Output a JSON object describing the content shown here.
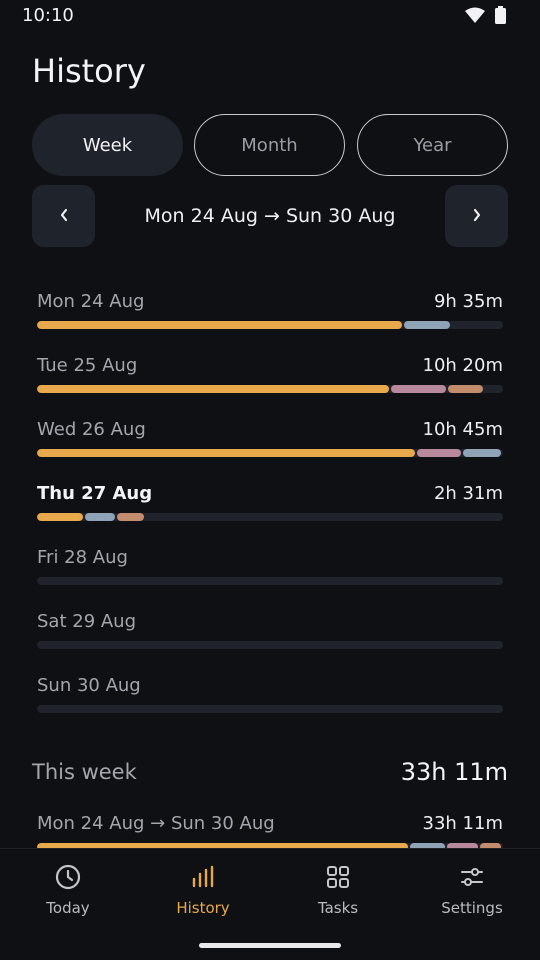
{
  "status_bar": {
    "time": "10:10",
    "wifi_icon": "wifi-icon",
    "battery_icon": "battery-icon"
  },
  "page": {
    "title": "History"
  },
  "range_tabs": [
    {
      "label": "Week",
      "active": true
    },
    {
      "label": "Month",
      "active": false
    },
    {
      "label": "Year",
      "active": false
    }
  ],
  "date_nav": {
    "prev_icon": "chevron-left-icon",
    "next_icon": "chevron-right-icon",
    "range": "Mon 24 Aug → Sun 30 Aug"
  },
  "colors": {
    "orange": "#e8a84c",
    "blue": "#8fa3b6",
    "pink": "#b8889c",
    "tan": "#c38c6c",
    "active_nav": "#e7a84a"
  },
  "days": [
    {
      "label": "Mon 24 Aug",
      "total": "9h 35m",
      "current": false,
      "segments": [
        {
          "color": "#e8a84c",
          "fraction": 0.788
        },
        {
          "color": "#8fa3b6",
          "fraction": 0.103
        }
      ]
    },
    {
      "label": "Tue 25 Aug",
      "total": "10h 20m",
      "current": false,
      "segments": [
        {
          "color": "#e8a84c",
          "fraction": 0.76
        },
        {
          "color": "#b8889c",
          "fraction": 0.122
        },
        {
          "color": "#c38c6c",
          "fraction": 0.079
        }
      ]
    },
    {
      "label": "Wed 26 Aug",
      "total": "10h 45m",
      "current": false,
      "segments": [
        {
          "color": "#e8a84c",
          "fraction": 0.815
        },
        {
          "color": "#b8889c",
          "fraction": 0.1
        },
        {
          "color": "#8fa3b6",
          "fraction": 0.085
        }
      ]
    },
    {
      "label": "Thu 27 Aug",
      "total": "2h 31m",
      "current": true,
      "segments": [
        {
          "color": "#e8a84c",
          "fraction": 0.103
        },
        {
          "color": "#8fa3b6",
          "fraction": 0.069
        },
        {
          "color": "#c38c6c",
          "fraction": 0.062
        }
      ]
    },
    {
      "label": "Fri 28 Aug",
      "total": "",
      "current": false,
      "segments": []
    },
    {
      "label": "Sat 29 Aug",
      "total": "",
      "current": false,
      "segments": []
    },
    {
      "label": "Sun 30 Aug",
      "total": "",
      "current": false,
      "segments": []
    }
  ],
  "week_summary": {
    "label": "This week",
    "total": "33h 11m",
    "range": "Mon 24 Aug → Sun 30 Aug",
    "range_total": "33h 11m",
    "segments": [
      {
        "color": "#e8a84c",
        "fraction": 0.8
      },
      {
        "color": "#8fa3b6",
        "fraction": 0.08
      },
      {
        "color": "#b8889c",
        "fraction": 0.07
      },
      {
        "color": "#c38c6c",
        "fraction": 0.05
      }
    ]
  },
  "bottom_nav": [
    {
      "label": "Today",
      "icon": "clock-icon",
      "active": false
    },
    {
      "label": "History",
      "icon": "bar-chart-icon",
      "active": true
    },
    {
      "label": "Tasks",
      "icon": "grid-icon",
      "active": false
    },
    {
      "label": "Settings",
      "icon": "sliders-icon",
      "active": false
    }
  ]
}
